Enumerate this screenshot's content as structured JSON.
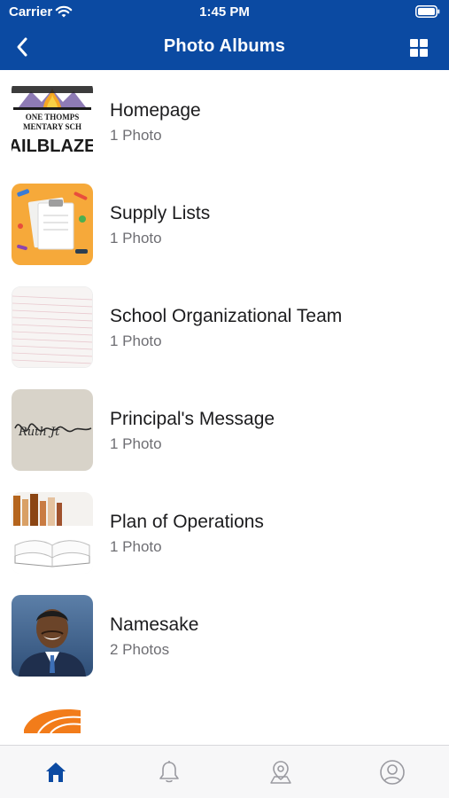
{
  "status_bar": {
    "carrier": "Carrier",
    "time": "1:45 PM"
  },
  "nav": {
    "title": "Photo Albums",
    "back_icon": "chevron-left-icon",
    "view_toggle_icon": "grid-icon"
  },
  "albums": [
    {
      "title": "Homepage",
      "count": "1 Photo",
      "thumb": "school-logo"
    },
    {
      "title": "Supply Lists",
      "count": "1 Photo",
      "thumb": "clipboard-supplies"
    },
    {
      "title": "School Organizational Team",
      "count": "1 Photo",
      "thumb": "lined-paper"
    },
    {
      "title": "Principal's Message",
      "count": "1 Photo",
      "thumb": "signature"
    },
    {
      "title": "Plan of Operations",
      "count": "1 Photo",
      "thumb": "open-book"
    },
    {
      "title": "Namesake",
      "count": "2 Photos",
      "thumb": "portrait"
    },
    {
      "title": "",
      "count": "",
      "thumb": "orange-logo"
    }
  ],
  "thumb_logo_text": {
    "line1": "ONE THOMPS",
    "line2": "MENTARY SCH",
    "line3": "AILBLAZE"
  },
  "signature_text": "Ruth Jt",
  "tabs": [
    {
      "name": "home",
      "icon": "home-icon",
      "active": true
    },
    {
      "name": "notifications",
      "icon": "bell-icon",
      "active": false
    },
    {
      "name": "locations",
      "icon": "map-pin-icon",
      "active": false
    },
    {
      "name": "account",
      "icon": "user-icon",
      "active": false
    }
  ],
  "colors": {
    "brand": "#0b4aa2",
    "tab_active": "#0b4aa2",
    "tab_inactive": "#9a9aa0"
  }
}
